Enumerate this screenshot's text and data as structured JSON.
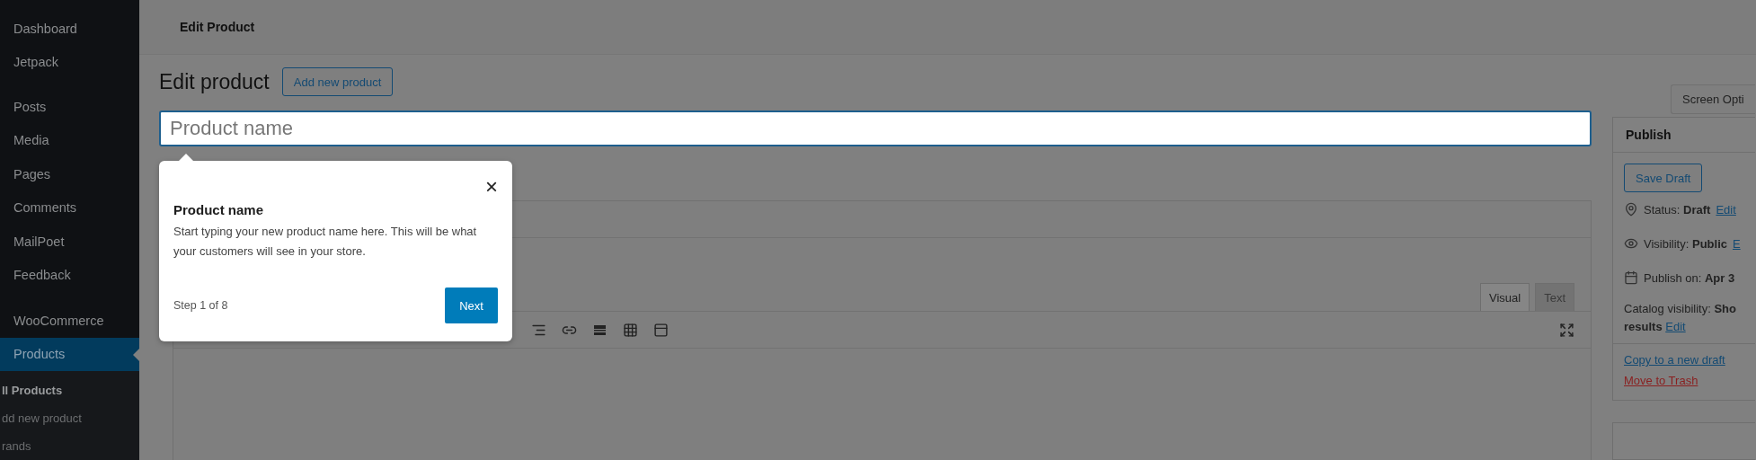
{
  "sidebar": {
    "items": [
      {
        "label": "Dashboard",
        "selected": false
      },
      {
        "label": "Jetpack",
        "selected": false
      },
      {
        "label": "Posts",
        "selected": false
      },
      {
        "label": "Media",
        "selected": false
      },
      {
        "label": "Pages",
        "selected": false
      },
      {
        "label": "Comments",
        "selected": false
      },
      {
        "label": "MailPoet",
        "selected": false
      },
      {
        "label": "Feedback",
        "selected": false
      },
      {
        "label": "WooCommerce",
        "selected": false
      },
      {
        "label": "Products",
        "selected": true
      }
    ],
    "submenu": [
      {
        "label": "ll Products",
        "selected": true
      },
      {
        "label": "dd new product",
        "selected": false
      },
      {
        "label": "rands",
        "selected": false
      }
    ]
  },
  "header": {
    "title": "Edit Product"
  },
  "page": {
    "title": "Edit product",
    "add_button": "Add new product",
    "screen_options": "Screen Opti"
  },
  "product_name": {
    "placeholder": "Product name"
  },
  "tour": {
    "title": "Product name",
    "body": "Start typing your new product name here. This will be what your customers will see in your store.",
    "close": "×",
    "step": "Step 1 of 8",
    "next": "Next"
  },
  "editor": {
    "tabs": [
      {
        "label": "Visual",
        "selected": true
      },
      {
        "label": "Text",
        "selected": false
      }
    ]
  },
  "publish": {
    "title": "Publish",
    "save_draft": "Save Draft",
    "rows": [
      {
        "kind": "status",
        "label": "Status:",
        "value": "Draft",
        "link": "Edit"
      },
      {
        "kind": "visibility",
        "label": "Visibility:",
        "value": "Public",
        "link": "E"
      },
      {
        "kind": "date",
        "label": "Publish on:",
        "value": "Apr 3"
      }
    ],
    "catalog": {
      "label": "Catalog visibility:",
      "value": "Sho",
      "value_2": "results",
      "link": "Edit"
    },
    "copy": "Copy to a new draft",
    "trash": "Move to Trash"
  }
}
